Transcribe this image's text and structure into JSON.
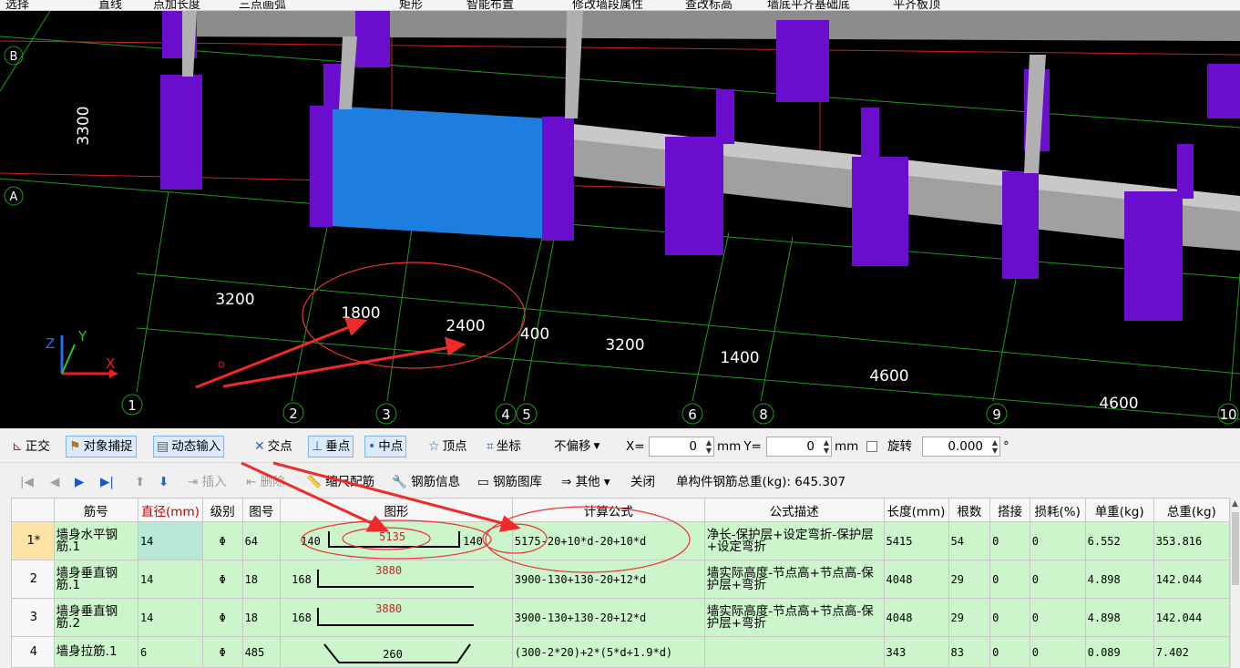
{
  "top_toolbar": {
    "items": [
      "选择",
      "直线",
      "点加长度",
      "三点画弧",
      "矩形",
      "智能布置",
      "修改墙段属性",
      "查改标高",
      "墙底平齐基础底",
      "平齐板顶"
    ]
  },
  "viewport": {
    "axis_rows": [
      "B",
      "A"
    ],
    "axis_cols": [
      "1",
      "2",
      "3",
      "4",
      "5",
      "6",
      "8",
      "9",
      "10"
    ],
    "row_dim": "3300",
    "dims": [
      "3200",
      "1800",
      "2400",
      "400",
      "3200",
      "1400",
      "4600",
      "4600"
    ],
    "axis_labels": {
      "z": "Z",
      "y": "Y",
      "x": "X"
    },
    "colors": {
      "column": "#6a0dcc",
      "wall": "#a0a0a0",
      "selected": "#1e7ee0",
      "gridline": "#1f9a1f",
      "axisline": "#cc2222"
    }
  },
  "snap_toolbar": {
    "ortho": "正交",
    "object_snap": "对象捕捉",
    "dynamic_input": "动态输入",
    "intersection": "交点",
    "perpendicular": "垂点",
    "midpoint": "中点",
    "vertex": "顶点",
    "coordinate": "坐标",
    "offset_select": "不偏移",
    "x_label": "X=",
    "x_value": "0",
    "x_unit": "mm",
    "y_label": "Y=",
    "y_value": "0",
    "y_unit": "mm",
    "rotate_label": "旋转",
    "rotate_value": "0.000",
    "rotate_unit": "°"
  },
  "rebar_toolbar": {
    "insert": "插入",
    "delete": "删除",
    "scale_rebar": "缩尺配筋",
    "rebar_info": "钢筋信息",
    "rebar_library": "钢筋图库",
    "other": "其他",
    "close": "关闭",
    "total_weight_label": "单构件钢筋总重(kg):",
    "total_weight": "645.307"
  },
  "grid": {
    "headers": [
      "筋号",
      "直径(mm)",
      "级别",
      "图号",
      "图形",
      "计算公式",
      "公式描述",
      "长度(mm)",
      "根数",
      "搭接",
      "损耗(%)",
      "单重(kg)",
      "总重(kg)"
    ],
    "rows": [
      {
        "idx": "1*",
        "name": "墙身水平钢筋.1",
        "dia": "14",
        "grade": "Φ",
        "fig": "64",
        "shape_left": "140",
        "shape_mid": "5135",
        "shape_right": "140",
        "formula": "5175-20+10*d-20+10*d",
        "desc": "净长-保护层+设定弯折-保护层+设定弯折",
        "length": "5415",
        "count": "54",
        "lap": "0",
        "loss": "0",
        "unit_w": "6.552",
        "total_w": "353.816"
      },
      {
        "idx": "2",
        "name": "墙身垂直钢筋.1",
        "dia": "14",
        "grade": "Φ",
        "fig": "18",
        "shape_left": "168",
        "shape_mid": "3880",
        "shape_right": "",
        "formula": "3900-130+130-20+12*d",
        "desc": "墙实际高度-节点高+节点高-保护层+弯折",
        "length": "4048",
        "count": "29",
        "lap": "0",
        "loss": "0",
        "unit_w": "4.898",
        "total_w": "142.044"
      },
      {
        "idx": "3",
        "name": "墙身垂直钢筋.2",
        "dia": "14",
        "grade": "Φ",
        "fig": "18",
        "shape_left": "168",
        "shape_mid": "3880",
        "shape_right": "",
        "formula": "3900-130+130-20+12*d",
        "desc": "墙实际高度-节点高+节点高-保护层+弯折",
        "length": "4048",
        "count": "29",
        "lap": "0",
        "loss": "0",
        "unit_w": "4.898",
        "total_w": "142.044"
      },
      {
        "idx": "4",
        "name": "墙身拉筋.1",
        "dia": "6",
        "grade": "Φ",
        "fig": "485",
        "shape_left": "",
        "shape_mid": "260",
        "shape_right": "",
        "formula": "(300-2*20)+2*(5*d+1.9*d)",
        "desc": "",
        "length": "343",
        "count": "83",
        "lap": "0",
        "loss": "0",
        "unit_w": "0.089",
        "total_w": "7.402"
      }
    ]
  }
}
